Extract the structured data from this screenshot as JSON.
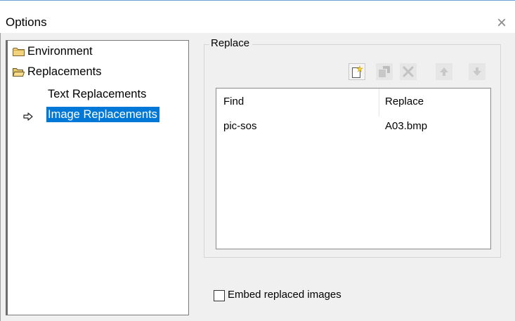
{
  "window": {
    "title": "Options",
    "close_glyph": "×"
  },
  "tree": {
    "items": [
      {
        "label": "Environment",
        "icon": "folder-closed-icon"
      },
      {
        "label": "Replacements",
        "icon": "folder-open-icon"
      },
      {
        "label": "Text Replacements"
      },
      {
        "label": "Image Replacements",
        "selected": true,
        "icon": "arrow-right-icon"
      }
    ]
  },
  "replace_group": {
    "legend": "Replace",
    "toolbar": [
      {
        "name": "new-icon",
        "enabled": true
      },
      {
        "name": "edit-icon",
        "enabled": false
      },
      {
        "name": "delete-icon",
        "enabled": false
      },
      {
        "name": "move-up-icon",
        "enabled": false
      },
      {
        "name": "move-down-icon",
        "enabled": false
      }
    ],
    "table": {
      "columns": [
        "Find",
        "Replace"
      ],
      "rows": [
        {
          "find": "pic-sos",
          "replace": "A03.bmp"
        }
      ]
    }
  },
  "embed_option": {
    "label": "Embed replaced images",
    "checked": false
  },
  "colors": {
    "selection": "#0078d7",
    "panel": "#f0f0f0"
  }
}
